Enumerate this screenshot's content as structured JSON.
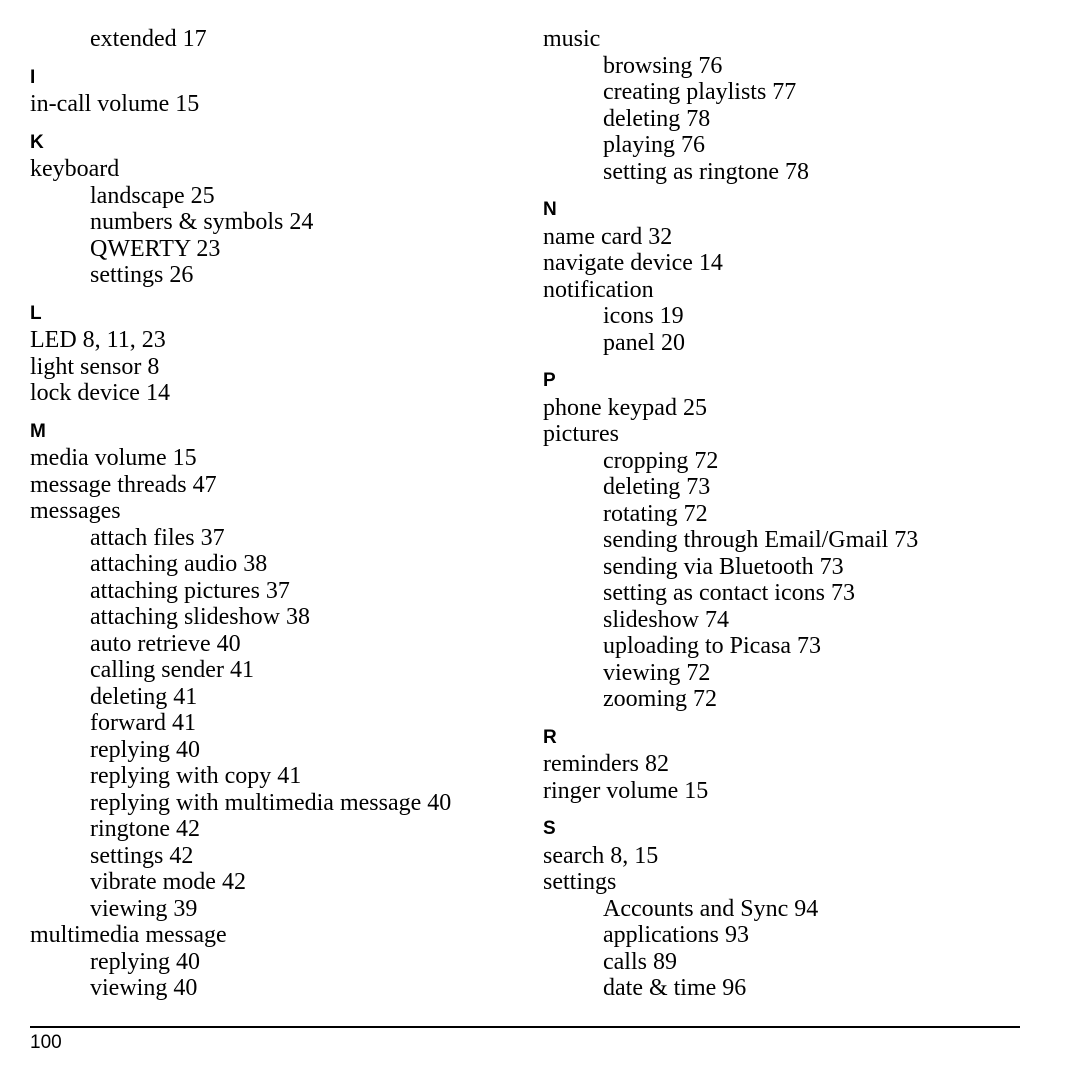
{
  "columns": [
    [
      {
        "t": "s",
        "text": "extended 17"
      },
      {
        "t": "h",
        "text": "I"
      },
      {
        "t": "m",
        "text": "in-call volume 15"
      },
      {
        "t": "h",
        "text": "K"
      },
      {
        "t": "m",
        "text": "keyboard"
      },
      {
        "t": "s",
        "text": "landscape 25"
      },
      {
        "t": "s",
        "text": "numbers & symbols 24"
      },
      {
        "t": "s",
        "text": "QWERTY 23"
      },
      {
        "t": "s",
        "text": "settings 26"
      },
      {
        "t": "h",
        "text": "L"
      },
      {
        "t": "m",
        "text": "LED 8, 11, 23"
      },
      {
        "t": "m",
        "text": "light sensor 8"
      },
      {
        "t": "m",
        "text": "lock device 14"
      },
      {
        "t": "h",
        "text": "M"
      },
      {
        "t": "m",
        "text": "media volume 15"
      },
      {
        "t": "m",
        "text": "message threads 47"
      },
      {
        "t": "m",
        "text": "messages"
      },
      {
        "t": "s",
        "text": "attach files 37"
      },
      {
        "t": "s",
        "text": "attaching audio 38"
      },
      {
        "t": "s",
        "text": "attaching pictures 37"
      },
      {
        "t": "s",
        "text": "attaching slideshow 38"
      },
      {
        "t": "s",
        "text": "auto retrieve 40"
      },
      {
        "t": "s",
        "text": "calling sender 41"
      },
      {
        "t": "s",
        "text": "deleting 41"
      },
      {
        "t": "s",
        "text": "forward 41"
      },
      {
        "t": "s",
        "text": "replying 40"
      },
      {
        "t": "s",
        "text": "replying with copy 41"
      },
      {
        "t": "s",
        "text": "replying with multimedia message 40"
      },
      {
        "t": "s",
        "text": "ringtone 42"
      },
      {
        "t": "s",
        "text": "settings 42"
      },
      {
        "t": "s",
        "text": "vibrate mode 42"
      },
      {
        "t": "s",
        "text": "viewing 39"
      },
      {
        "t": "m",
        "text": "multimedia message"
      },
      {
        "t": "s",
        "text": "replying 40"
      },
      {
        "t": "s",
        "text": "viewing 40"
      }
    ],
    [
      {
        "t": "m",
        "text": "music"
      },
      {
        "t": "s",
        "text": "browsing 76"
      },
      {
        "t": "s",
        "text": "creating playlists 77"
      },
      {
        "t": "s",
        "text": "deleting 78"
      },
      {
        "t": "s",
        "text": "playing 76"
      },
      {
        "t": "s",
        "text": "setting as ringtone 78"
      },
      {
        "t": "h",
        "text": "N"
      },
      {
        "t": "m",
        "text": "name card 32"
      },
      {
        "t": "m",
        "text": "navigate device 14"
      },
      {
        "t": "m",
        "text": "notification"
      },
      {
        "t": "s",
        "text": "icons 19"
      },
      {
        "t": "s",
        "text": "panel 20"
      },
      {
        "t": "h",
        "text": "P"
      },
      {
        "t": "m",
        "text": "phone keypad 25"
      },
      {
        "t": "m",
        "text": "pictures"
      },
      {
        "t": "s",
        "text": "cropping 72"
      },
      {
        "t": "s",
        "text": "deleting 73"
      },
      {
        "t": "s",
        "text": "rotating 72"
      },
      {
        "t": "s",
        "text": "sending through Email/Gmail 73"
      },
      {
        "t": "s",
        "text": "sending via Bluetooth 73"
      },
      {
        "t": "s",
        "text": "setting as contact icons 73"
      },
      {
        "t": "s",
        "text": "slideshow 74"
      },
      {
        "t": "s",
        "text": "uploading to Picasa 73"
      },
      {
        "t": "s",
        "text": "viewing 72"
      },
      {
        "t": "s",
        "text": "zooming 72"
      },
      {
        "t": "h",
        "text": "R"
      },
      {
        "t": "m",
        "text": "reminders 82"
      },
      {
        "t": "m",
        "text": "ringer volume 15"
      },
      {
        "t": "h",
        "text": "S"
      },
      {
        "t": "m",
        "text": "search 8, 15"
      },
      {
        "t": "m",
        "text": "settings"
      },
      {
        "t": "s",
        "text": "Accounts and Sync 94"
      },
      {
        "t": "s",
        "text": "applications 93"
      },
      {
        "t": "s",
        "text": "calls 89"
      },
      {
        "t": "s",
        "text": "date & time 96"
      }
    ]
  ],
  "footer": {
    "page_number": "100"
  }
}
